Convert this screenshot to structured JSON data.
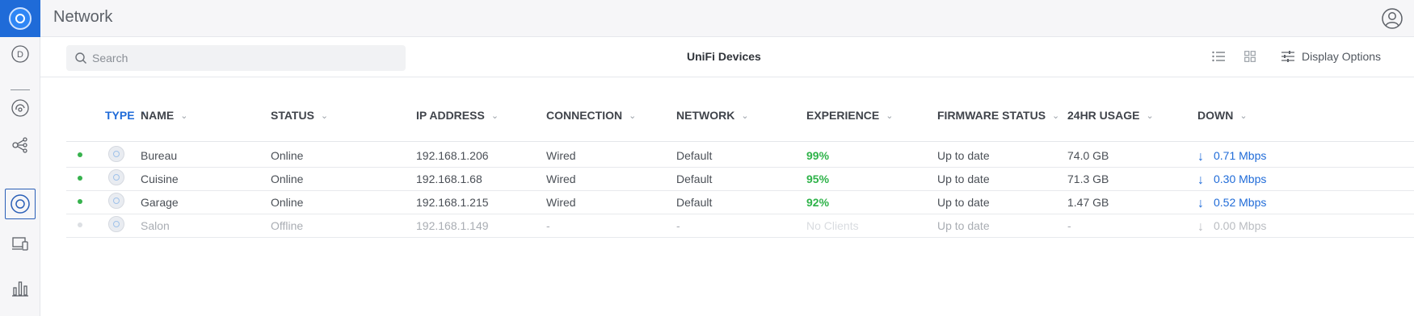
{
  "app": {
    "title": "Network"
  },
  "sidebar": {
    "items": [
      {
        "icon": "dashboard-icon",
        "letter": "D"
      },
      {
        "icon": "statistics-icon"
      },
      {
        "icon": "topology-icon"
      },
      {
        "icon": "unifi-devices-icon",
        "active": true
      },
      {
        "icon": "clients-icon"
      },
      {
        "icon": "insights-icon"
      }
    ]
  },
  "toolbar": {
    "search_placeholder": "Search",
    "heading": "UniFi Devices",
    "display_options_label": "Display Options"
  },
  "table": {
    "columns": [
      {
        "key": "type",
        "label": "TYPE",
        "sorted": true,
        "chevron": "^"
      },
      {
        "key": "name",
        "label": "NAME",
        "chevron": "⌄"
      },
      {
        "key": "status",
        "label": "STATUS",
        "chevron": "⌄"
      },
      {
        "key": "ip",
        "label": "IP ADDRESS",
        "chevron": "⌄"
      },
      {
        "key": "connection",
        "label": "CONNECTION",
        "chevron": "⌄"
      },
      {
        "key": "network",
        "label": "NETWORK",
        "chevron": "⌄"
      },
      {
        "key": "experience",
        "label": "EXPERIENCE",
        "chevron": "⌄"
      },
      {
        "key": "firmware",
        "label": "FIRMWARE STATUS",
        "chevron": "⌄"
      },
      {
        "key": "usage",
        "label": "24HR USAGE",
        "chevron": "⌄"
      },
      {
        "key": "down",
        "label": "DOWN",
        "chevron": "⌄"
      }
    ],
    "rows": [
      {
        "name": "Bureau",
        "status": "Online",
        "ip": "192.168.1.206",
        "connection": "Wired",
        "network": "Default",
        "experience": "99%",
        "firmware": "Up to date",
        "usage": "74.0 GB",
        "down": "0.71 Mbps",
        "down_arrow": "↓"
      },
      {
        "name": "Cuisine",
        "status": "Online",
        "ip": "192.168.1.68",
        "connection": "Wired",
        "network": "Default",
        "experience": "95%",
        "firmware": "Up to date",
        "usage": "71.3 GB",
        "down": "0.30 Mbps",
        "down_arrow": "↓"
      },
      {
        "name": "Garage",
        "status": "Online",
        "ip": "192.168.1.215",
        "connection": "Wired",
        "network": "Default",
        "experience": "92%",
        "firmware": "Up to date",
        "usage": "1.47 GB",
        "down": "0.52 Mbps",
        "down_arrow": "↓"
      },
      {
        "name": "Salon",
        "status": "Offline",
        "ip": "192.168.1.149",
        "connection": "-",
        "network": "-",
        "experience": "No Clients",
        "firmware": "Up to date",
        "usage": "-",
        "down": "0.00 Mbps",
        "down_arrow": "↓"
      }
    ]
  },
  "colors": {
    "accent": "#1f6bd8",
    "online": "#37b24d",
    "experience_good": "#2fb34a",
    "offline_text": "#a9adb3"
  }
}
